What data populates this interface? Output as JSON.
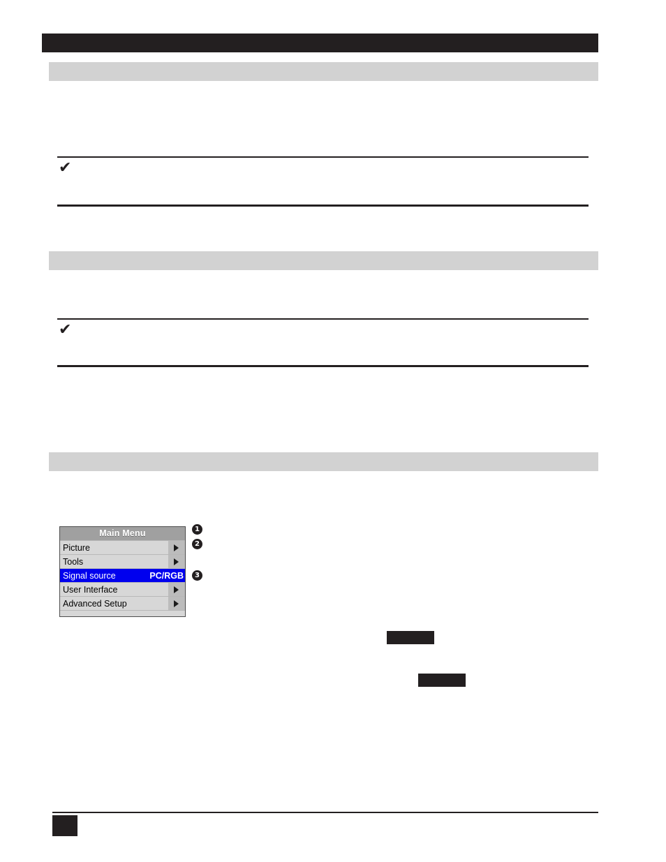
{
  "page": {
    "title_bar_text": "",
    "sections": [
      {
        "heading": ""
      },
      {
        "heading": ""
      },
      {
        "heading": ""
      }
    ],
    "notes": [
      {
        "icon": "check-icon",
        "text": ""
      },
      {
        "icon": "check-icon",
        "text": ""
      }
    ],
    "body_blocks": [
      {
        "text": ""
      },
      {
        "text": ""
      },
      {
        "text": ""
      }
    ]
  },
  "osd_menu": {
    "title": "Main Menu",
    "rows": [
      {
        "label": "Picture",
        "value": "",
        "has_arrow": true,
        "selected": false
      },
      {
        "label": "Tools",
        "value": "",
        "has_arrow": true,
        "selected": false
      },
      {
        "label": "Signal source",
        "value": "PC/RGB",
        "has_arrow": false,
        "selected": true
      },
      {
        "label": "User Interface",
        "value": "",
        "has_arrow": true,
        "selected": false
      },
      {
        "label": "Advanced Setup",
        "value": "",
        "has_arrow": true,
        "selected": false
      }
    ],
    "colors": {
      "title_bar": "#a0a0a0",
      "row_bg": "#d7d7d7",
      "arrow_cell": "#bcbcbc",
      "selected_bg": "#0000ee",
      "selected_fg": "#ffffff",
      "border": "#4d4d4d"
    }
  },
  "callouts": [
    {
      "number": "1"
    },
    {
      "number": "2"
    },
    {
      "number": "3"
    }
  ],
  "key_boxes": [
    {
      "label": ""
    },
    {
      "label": ""
    }
  ],
  "footer": {
    "page_number": "",
    "text": ""
  },
  "colors": {
    "ink": "#231f20",
    "section_band": "#d2d2d2",
    "paper": "#ffffff"
  }
}
